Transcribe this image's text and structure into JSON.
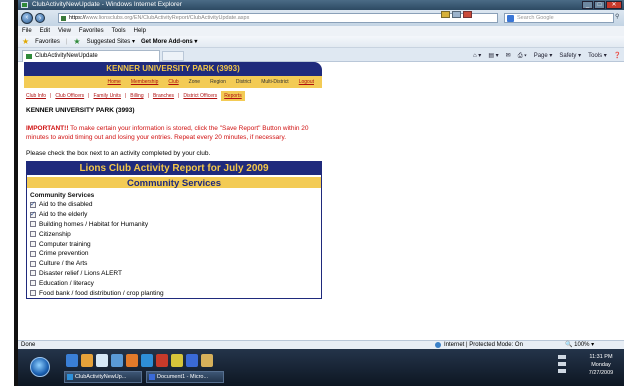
{
  "window": {
    "title": "ClubActivityNewUpdate - Windows Internet Explorer"
  },
  "address": {
    "url_scheme": "https://",
    "url_domain": "www.lionsclubs.org",
    "url_path": "/EN/ClubActivityReport/ClubActivityUpdate.aspx",
    "search_placeholder": "Search Google"
  },
  "menu": [
    "File",
    "Edit",
    "View",
    "Favorites",
    "Tools",
    "Help"
  ],
  "favorites_bar": {
    "favorites_label": "Favorites",
    "suggested_sites": "Suggested Sites ▾",
    "addons": "Get More Add-ons ▾"
  },
  "tab": {
    "label": "ClubActivityNewUpdate"
  },
  "command_bar": [
    "Page ▾",
    "Safety ▾",
    "Tools ▾"
  ],
  "site": {
    "banner": "KENNER UNIVERSITY PARK (3993)",
    "nav1": [
      "Home",
      "Membership",
      "Club",
      "Zone",
      "Region",
      "District",
      "Multi-District",
      "Logout"
    ],
    "nav2": [
      "Club Info",
      "Club Officers",
      "Family Units",
      "Billing",
      "Branches",
      "District Officers",
      "Reports"
    ],
    "club_line": "KENNER UNIVERSITY PARK (3993)",
    "important_label": "IMPORTANT!!",
    "important_text": " To make certain your information is stored, click the \"Save Report\" Button within 20 minutes to avoid timing out and losing your entries. Repeat every 20 minutes, if necessary.",
    "instruction": "Please check the box next to an activity completed by your club.",
    "report_title": "Lions Club Activity Report for July 2009",
    "section_title": "Community Services",
    "section_label": "Community Services",
    "items": [
      {
        "label": "Aid to the disabled",
        "checked": true
      },
      {
        "label": "Aid to the elderly",
        "checked": true
      },
      {
        "label": "Building homes / Habitat for Humanity",
        "checked": false
      },
      {
        "label": "Citizenship",
        "checked": false
      },
      {
        "label": "Computer training",
        "checked": false
      },
      {
        "label": "Crime prevention",
        "checked": false
      },
      {
        "label": "Culture / the Arts",
        "checked": false
      },
      {
        "label": "Disaster relief / Lions ALERT",
        "checked": false
      },
      {
        "label": "Education / literacy",
        "checked": false
      },
      {
        "label": "Food bank / food distribution / crop planting",
        "checked": false
      }
    ]
  },
  "status": {
    "left": "Done",
    "mode": "Internet | Protected Mode: On",
    "zoom": "100%"
  },
  "taskbar": {
    "buttons": [
      "ClubActivityNewUp...",
      "Document1 - Micro..."
    ],
    "time": "11:31 PM",
    "day": "Monday",
    "date": "7/27/2009"
  },
  "colors": {
    "navy": "#1f2a7c",
    "gold": "#f3cb55",
    "red": "#d01010"
  }
}
